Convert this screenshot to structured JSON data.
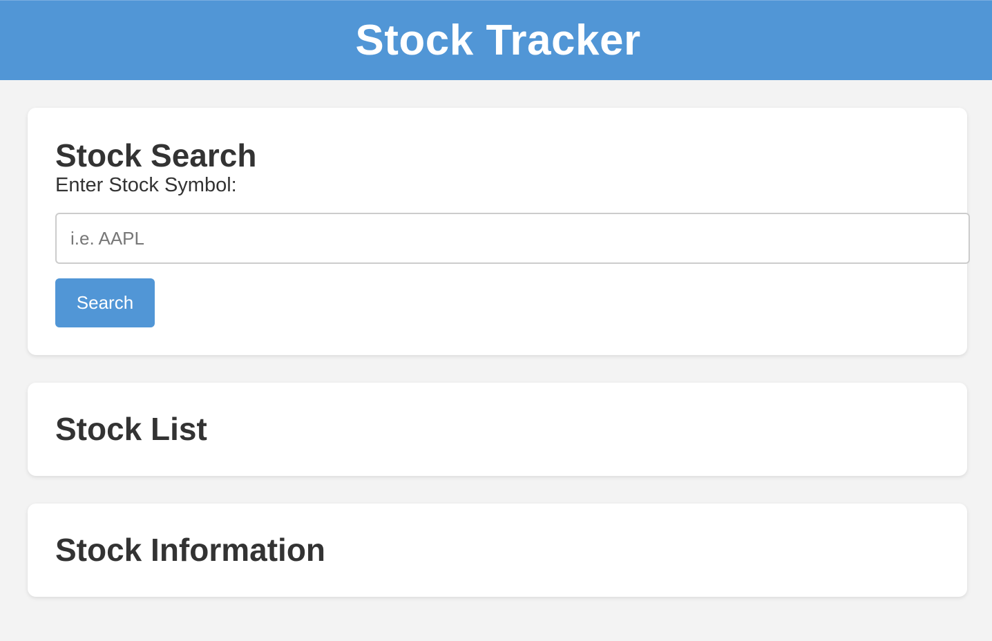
{
  "header": {
    "title": "Stock Tracker",
    "background_color": "#5196d6"
  },
  "search_section": {
    "heading": "Stock Search",
    "label": "Enter Stock Symbol:",
    "input": {
      "value": "",
      "placeholder": "i.e. AAPL"
    },
    "button_label": "Search",
    "button_color": "#5196d6"
  },
  "list_section": {
    "heading": "Stock List"
  },
  "info_section": {
    "heading": "Stock Information"
  },
  "colors": {
    "page_background": "#f3f3f3",
    "card_background": "#ffffff",
    "text": "#333333"
  }
}
